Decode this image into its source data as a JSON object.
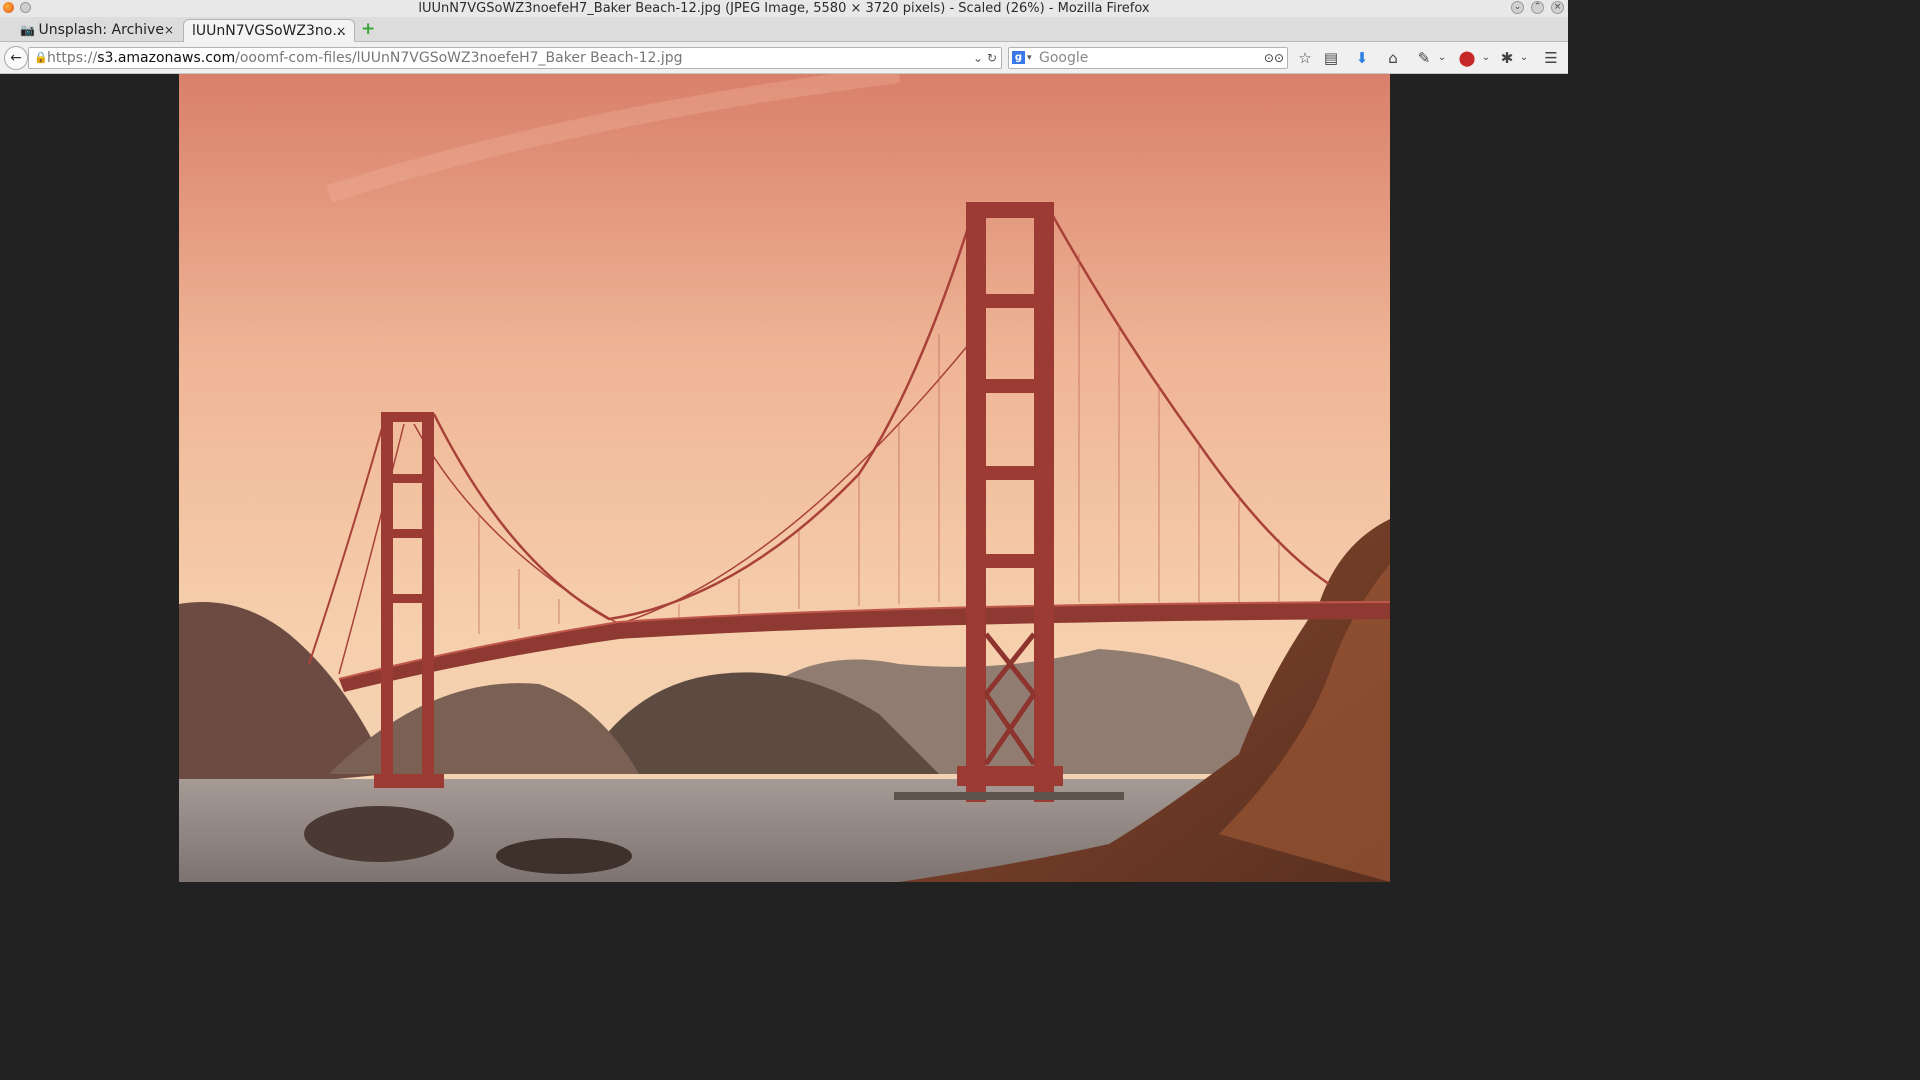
{
  "window": {
    "title": "lUUnN7VGSoWZ3noefeH7_Baker Beach-12.jpg (JPEG Image, 5580 × 3720 pixels) - Scaled (26%) - Mozilla Firefox"
  },
  "tabs": [
    {
      "label": "Unsplash: Archive",
      "close": "×",
      "icon": "camera-icon"
    },
    {
      "label": "lUUnN7VGSoWZ3no…",
      "close": "×"
    }
  ],
  "new_tab_label": "+",
  "navbar": {
    "back": "←",
    "url_prefix": "https://",
    "url_host": "s3.amazonaws.com",
    "url_path": "/ooomf-com-files/lUUnN7VGSoWZ3noefeH7_Baker Beach-12.jpg",
    "search_placeholder": "Google",
    "search_engine_letter": "g"
  },
  "toolbar_icons": [
    "bookmark-star-icon",
    "reading-list-icon",
    "download-arrow-icon",
    "home-icon",
    "eyedropper-icon",
    "adblock-icon",
    "puzzle-icon",
    "hamburger-menu-icon"
  ],
  "colors": {
    "tab_active": "#f3f3f3",
    "background": "#222222",
    "download_blue": "#2a7de1",
    "adblock_red": "#c62828"
  }
}
